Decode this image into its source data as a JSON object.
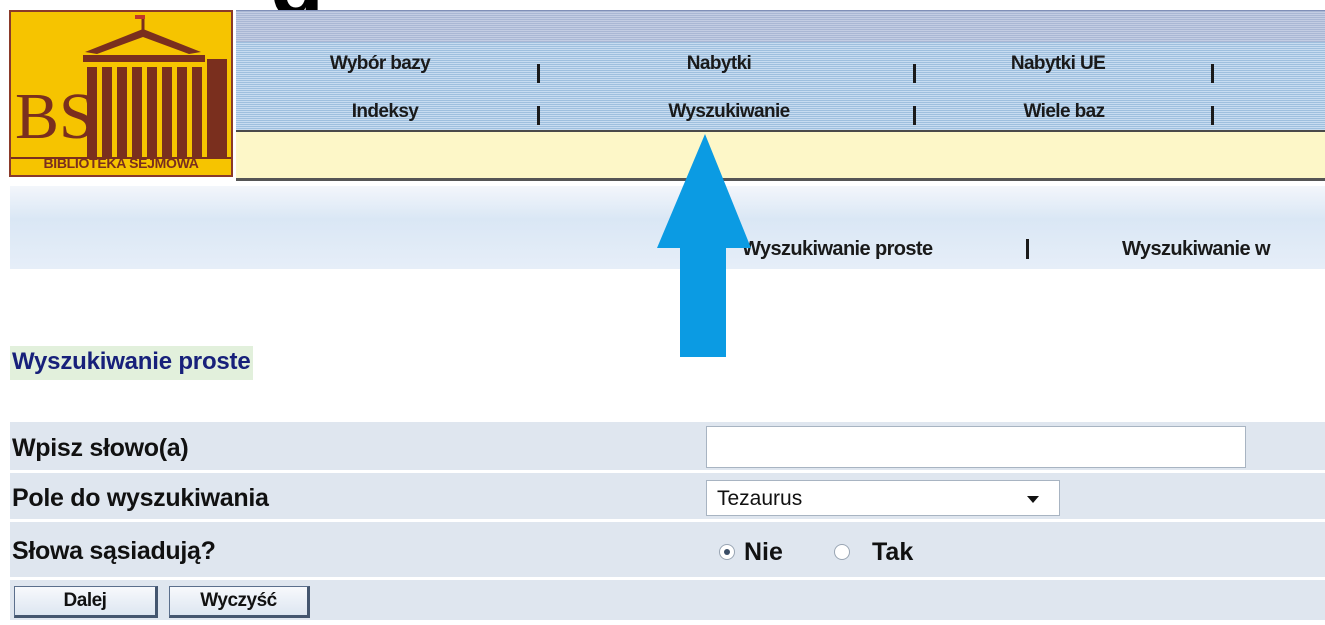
{
  "header": {
    "cropped_heading": "g",
    "logo": {
      "monogram": "BS",
      "caption": "BIBLIOTEKA SEJMOWA"
    },
    "nav_row_1": [
      "Wybór bazy",
      "Nabytki",
      "Nabytki UE"
    ],
    "nav_row_2": [
      "Indeksy",
      "Wyszukiwanie",
      "Wiele baz"
    ]
  },
  "subnav": {
    "items": [
      "Wyszukiwanie proste",
      "Wyszukiwanie w"
    ]
  },
  "annotation": {
    "arrow_color": "#0b9be3"
  },
  "page": {
    "title": "Wyszukiwanie proste"
  },
  "form": {
    "word_label": "Wpisz słowo(a)",
    "word_value": "",
    "field_label": "Pole do wyszukiwania",
    "field_value": "Tezaurus",
    "adjacent_label": "Słowa sąsiadują?",
    "options": [
      {
        "label": "Nie",
        "checked": true
      },
      {
        "label": "Tak",
        "checked": false
      }
    ],
    "submit_label": "Dalej",
    "clear_label": "Wyczyść"
  },
  "colors": {
    "title_text": "#17207a",
    "logo_bg": "#f6c400",
    "logo_accent": "#7a2f1e"
  }
}
